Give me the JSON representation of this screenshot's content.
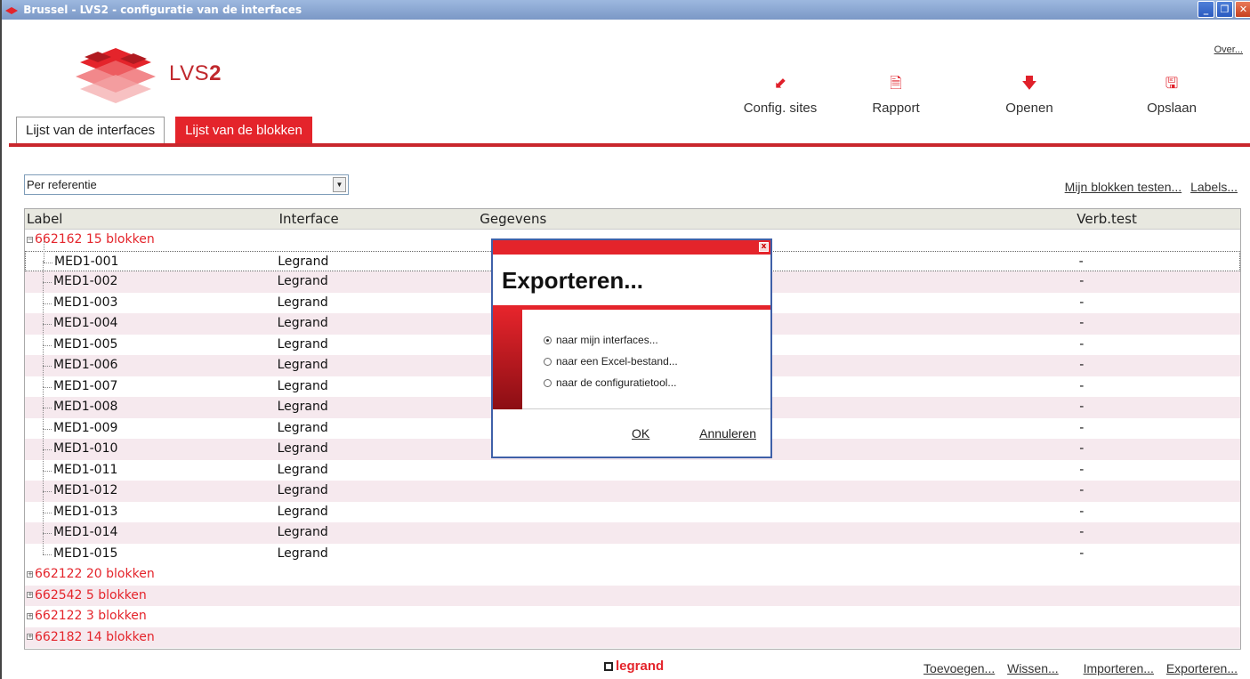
{
  "window": {
    "title": "Brussel  -  LVS2 - configuratie van de interfaces",
    "over_link": "Over..."
  },
  "logo": {
    "text_prefix": "LVS",
    "text_suffix": "2"
  },
  "toolbar": [
    {
      "label": "Config. sites",
      "icon": "config-sites-icon"
    },
    {
      "label": "Rapport",
      "icon": "report-icon"
    },
    {
      "label": "Openen",
      "icon": "open-arrow-icon"
    },
    {
      "label": "Opslaan",
      "icon": "save-icon"
    }
  ],
  "tabs": [
    {
      "label": "Lijst van de interfaces",
      "active": false
    },
    {
      "label": "Lijst van de blokken",
      "active": true
    }
  ],
  "filter": {
    "selected": "Per referentie"
  },
  "links_top": [
    "Mijn blokken testen...",
    "Labels..."
  ],
  "table": {
    "columns": [
      "Label",
      "Interface",
      "Gegevens",
      "Verb.test"
    ],
    "groups": [
      {
        "label": "662162 15 blokken",
        "expanded": true,
        "rows": [
          {
            "label": "MED1-001",
            "interface": "Legrand",
            "data": "",
            "test": "-"
          },
          {
            "label": "MED1-002",
            "interface": "Legrand",
            "data": "",
            "test": "-"
          },
          {
            "label": "MED1-003",
            "interface": "Legrand",
            "data": "",
            "test": "-"
          },
          {
            "label": "MED1-004",
            "interface": "Legrand",
            "data": "",
            "test": "-"
          },
          {
            "label": "MED1-005",
            "interface": "Legrand",
            "data": "",
            "test": "-"
          },
          {
            "label": "MED1-006",
            "interface": "Legrand",
            "data": "",
            "test": "-"
          },
          {
            "label": "MED1-007",
            "interface": "Legrand",
            "data": "",
            "test": "-"
          },
          {
            "label": "MED1-008",
            "interface": "Legrand",
            "data": "",
            "test": "-"
          },
          {
            "label": "MED1-009",
            "interface": "Legrand",
            "data": "",
            "test": "-"
          },
          {
            "label": "MED1-010",
            "interface": "Legrand",
            "data": "",
            "test": "-"
          },
          {
            "label": "MED1-011",
            "interface": "Legrand",
            "data": "",
            "test": "-"
          },
          {
            "label": "MED1-012",
            "interface": "Legrand",
            "data": "",
            "test": "-"
          },
          {
            "label": "MED1-013",
            "interface": "Legrand",
            "data": "",
            "test": "-"
          },
          {
            "label": "MED1-014",
            "interface": "Legrand",
            "data": "",
            "test": "-"
          },
          {
            "label": "MED1-015",
            "interface": "Legrand",
            "data": "",
            "test": "-"
          }
        ]
      },
      {
        "label": "662122 20 blokken",
        "expanded": false,
        "rows": []
      },
      {
        "label": "662542 5 blokken",
        "expanded": false,
        "rows": []
      },
      {
        "label": "662122 3 blokken",
        "expanded": false,
        "rows": []
      },
      {
        "label": "662182 14 blokken",
        "expanded": false,
        "rows": []
      }
    ]
  },
  "footer": {
    "brand": "legrand",
    "links": [
      "Toevoegen...",
      "Wissen...",
      "Importeren...",
      "Exporteren..."
    ]
  },
  "dialog": {
    "title": "Exporteren...",
    "options": [
      {
        "label": "naar mijn interfaces...",
        "checked": true
      },
      {
        "label": "naar een Excel-bestand...",
        "checked": false
      },
      {
        "label": "naar de configuratietool...",
        "checked": false
      }
    ],
    "ok": "OK",
    "cancel": "Annuleren"
  },
  "colors": {
    "accent": "#e4242b",
    "titlebar": "#7b98c6",
    "row_alt": "#f6e9ee"
  }
}
